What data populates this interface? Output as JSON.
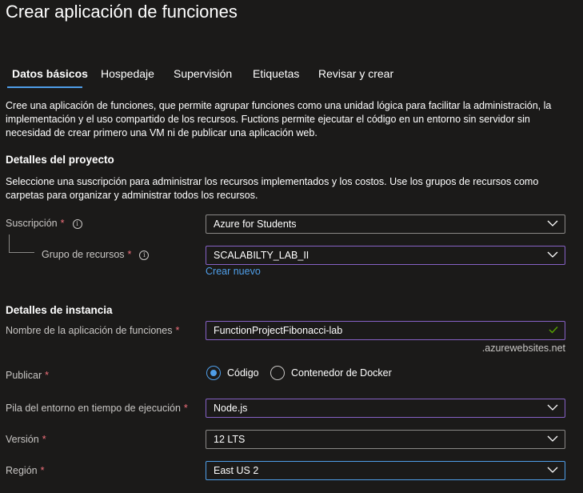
{
  "page": {
    "title": "Crear aplicación de funciones"
  },
  "tabs": [
    {
      "label": "Datos básicos",
      "active": true
    },
    {
      "label": "Hospedaje"
    },
    {
      "label": "Supervisión"
    },
    {
      "label": "Etiquetas"
    },
    {
      "label": "Revisar y crear"
    }
  ],
  "intro": "Cree una aplicación de funciones, que permite agrupar funciones como una unidad lógica para facilitar la administración, la implementación y el uso compartido de los recursos. Fuctions permite ejecutar el código en un entorno sin servidor sin necesidad de crear primero una VM ni de publicar una aplicación web.",
  "project": {
    "heading": "Detalles del proyecto",
    "description": "Seleccione una suscripción para administrar los recursos implementados y los costos. Use los grupos de recursos como carpetas para organizar y administrar todos los recursos.",
    "subscription": {
      "label": "Suscripción",
      "required": "*",
      "value": "Azure for Students"
    },
    "resource_group": {
      "label": "Grupo de recursos",
      "required": "*",
      "value": "SCALABILTY_LAB_II",
      "create_new_link": "Crear nuevo"
    }
  },
  "instance": {
    "heading": "Detalles de instancia",
    "app_name": {
      "label": "Nombre de la aplicación de funciones",
      "required": "*",
      "value": "FunctionProjectFibonacci-lab",
      "suffix": ".azurewebsites.net"
    },
    "publish": {
      "label": "Publicar",
      "required": "*",
      "options": [
        {
          "label": "Código",
          "selected": true
        },
        {
          "label": "Contenedor de Docker",
          "selected": false
        }
      ]
    },
    "runtime_stack": {
      "label": "Pila del entorno en tiempo de ejecución",
      "required": "*",
      "value": "Node.js"
    },
    "version": {
      "label": "Versión",
      "required": "*",
      "value": "12 LTS"
    },
    "region": {
      "label": "Región",
      "required": "*",
      "value": "East US 2"
    }
  },
  "colors": {
    "background": "#1b1a19",
    "accent": "#4f9ee8",
    "required": "#f1707b",
    "focus_border": "#8661c5",
    "valid_check": "#57a300"
  },
  "icons": [
    "info-icon",
    "chevron-down-icon",
    "checkmark-icon"
  ]
}
